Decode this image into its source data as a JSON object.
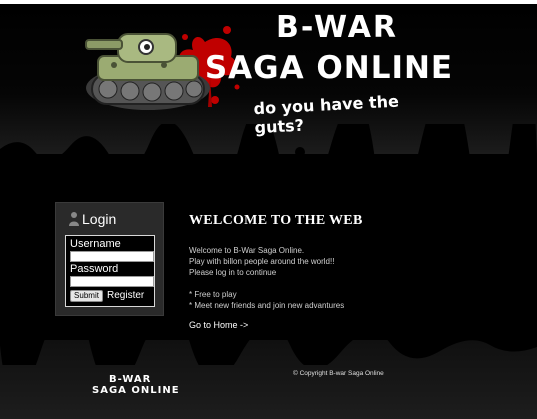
{
  "header": {
    "logo_line1": "B-WAR",
    "logo_line2": "SAGA ONLINE",
    "tagline": "do you have the guts?"
  },
  "login": {
    "title": "Login",
    "username_label": "Username",
    "username_value": "",
    "password_label": "Password",
    "password_value": "",
    "submit_label": "Submit",
    "register_label": "Register"
  },
  "main": {
    "title": "WELCOME TO THE WEB",
    "intro_lines": [
      "Welcome to B-War Saga Online.",
      "Play with billon people around the world!!",
      "Please log in to continue"
    ],
    "features": [
      "* Free to play",
      "* Meet new friends and join new advantures"
    ],
    "home_link": "Go to Home ->"
  },
  "footer": {
    "logo_line1": "B-WAR",
    "logo_line2": "SAGA ONLINE",
    "copyright": "© Copyright B-war Saga Online"
  },
  "colors": {
    "background": "#000000",
    "panel": "#2a2a2a",
    "blood_red": "#c00000",
    "tank_green": "#9bab72"
  }
}
